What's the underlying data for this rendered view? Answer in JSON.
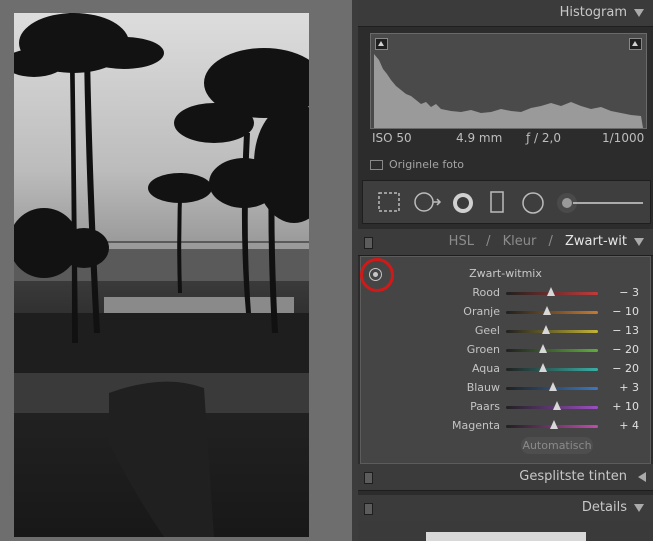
{
  "histogram_panel": {
    "title": "Histogram"
  },
  "exif": {
    "iso": "ISO 50",
    "focal": "4.9 mm",
    "aperture": "ƒ / 2,0",
    "shutter": "1/1000"
  },
  "original_photo": "Originele foto",
  "hsl_panel": {
    "tabs": [
      "HSL",
      "/",
      "Kleur",
      "/",
      "Zwart-wit"
    ],
    "active_tab": "Zwart-wit",
    "mix_title": "Zwart-witmix",
    "sliders": [
      {
        "label": "Rood",
        "value": "− 3",
        "pos": 0.49,
        "color": "#c23b3b"
      },
      {
        "label": "Oranje",
        "value": "− 10",
        "pos": 0.45,
        "color": "#c77a2e"
      },
      {
        "label": "Geel",
        "value": "− 13",
        "pos": 0.44,
        "color": "#c4b33a"
      },
      {
        "label": "Groen",
        "value": "− 20",
        "pos": 0.4,
        "color": "#5fae3c"
      },
      {
        "label": "Aqua",
        "value": "− 20",
        "pos": 0.4,
        "color": "#3ab0a6"
      },
      {
        "label": "Blauw",
        "value": "+ 3",
        "pos": 0.51,
        "color": "#3a78c4"
      },
      {
        "label": "Paars",
        "value": "+ 10",
        "pos": 0.55,
        "color": "#9b4fc2"
      },
      {
        "label": "Magenta",
        "value": "+ 4",
        "pos": 0.52,
        "color": "#c24bb0"
      }
    ],
    "auto_button": "Automatisch"
  },
  "split_toning": {
    "title": "Gesplitste tinten"
  },
  "details": {
    "title": "Details"
  },
  "colors": {
    "panel_bg": "#2c2c2c",
    "header_bg": "#3b3b3b",
    "highlight": "#d01a1a"
  }
}
